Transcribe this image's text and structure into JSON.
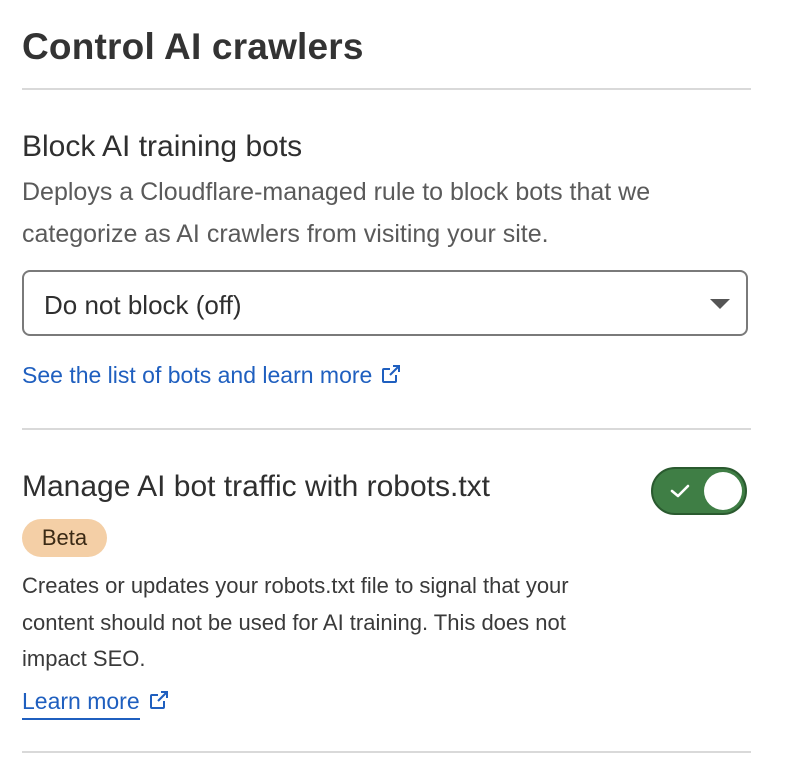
{
  "page": {
    "title": "Control AI crawlers"
  },
  "block_section": {
    "title": "Block AI training bots",
    "description": "Deploys a Cloudflare-managed rule to block bots that we categorize as AI crawlers from visiting your site.",
    "select": {
      "value": "Do not block (off)",
      "icon": "chevron-down-icon"
    },
    "link": {
      "label": "See the list of bots and learn more",
      "icon": "external-link-icon"
    }
  },
  "robots_section": {
    "title": "Manage AI bot traffic with robots.txt",
    "badge": "Beta",
    "toggle": {
      "state": "on",
      "icon": "check-icon",
      "color": "#3f7e45"
    },
    "description": "Creates or updates your robots.txt file to signal that your content should not be used for AI training. This does not impact SEO.",
    "link": {
      "label": "Learn more",
      "icon": "external-link-icon"
    }
  },
  "colors": {
    "link": "#1f5fbf",
    "badge_bg": "#f4cfa6",
    "divider": "#d9d9d9"
  }
}
